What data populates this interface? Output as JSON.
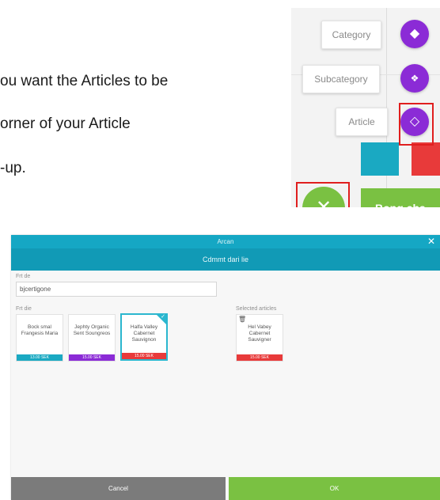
{
  "document": {
    "line1": "ou want the Articles to be",
    "line2": "orner of your Article",
    "line3": "-up."
  },
  "fab_menu": {
    "items": [
      {
        "label": "Category",
        "icon": "diamond-icon"
      },
      {
        "label": "Subcategory",
        "icon": "four-diamonds-icon"
      },
      {
        "label": "Article",
        "icon": "diamond-outline-icon"
      }
    ],
    "close_icon": "close-icon",
    "green_tile_text": "Bong cha",
    "colors": {
      "purple": "#8b2bd6",
      "green": "#7ac142",
      "teal": "#1aa9c2",
      "red": "#e83a3a",
      "highlight": "#e01e1e"
    }
  },
  "modal": {
    "top_title": "Arcan",
    "title": "Cdmmt dari lie",
    "name_label": "Frt de",
    "name_value": "bjcertigone",
    "articles_label": "Frt die",
    "selected_label": "Selected articles",
    "articles": [
      {
        "name": "Bock smal Frangesis Maria",
        "price": "13.00 SEK",
        "color": "#1aa9c2",
        "selected": false
      },
      {
        "name": "Jephty Organic Sent Soungreos",
        "price": "15.00 SEK",
        "color": "#8b2bd6",
        "selected": false
      },
      {
        "name": "Halfa Valley Cabernet Sauvignon",
        "price": "15.00 SEK",
        "color": "#e83a3a",
        "selected": true
      }
    ],
    "selected": [
      {
        "name": "Hel Vabey Cabernet Sauvigner",
        "price": "15.00 SEK",
        "color": "#e83a3a"
      }
    ],
    "cancel_label": "Cancel",
    "ok_label": "OK",
    "close_icon": "close-icon"
  }
}
